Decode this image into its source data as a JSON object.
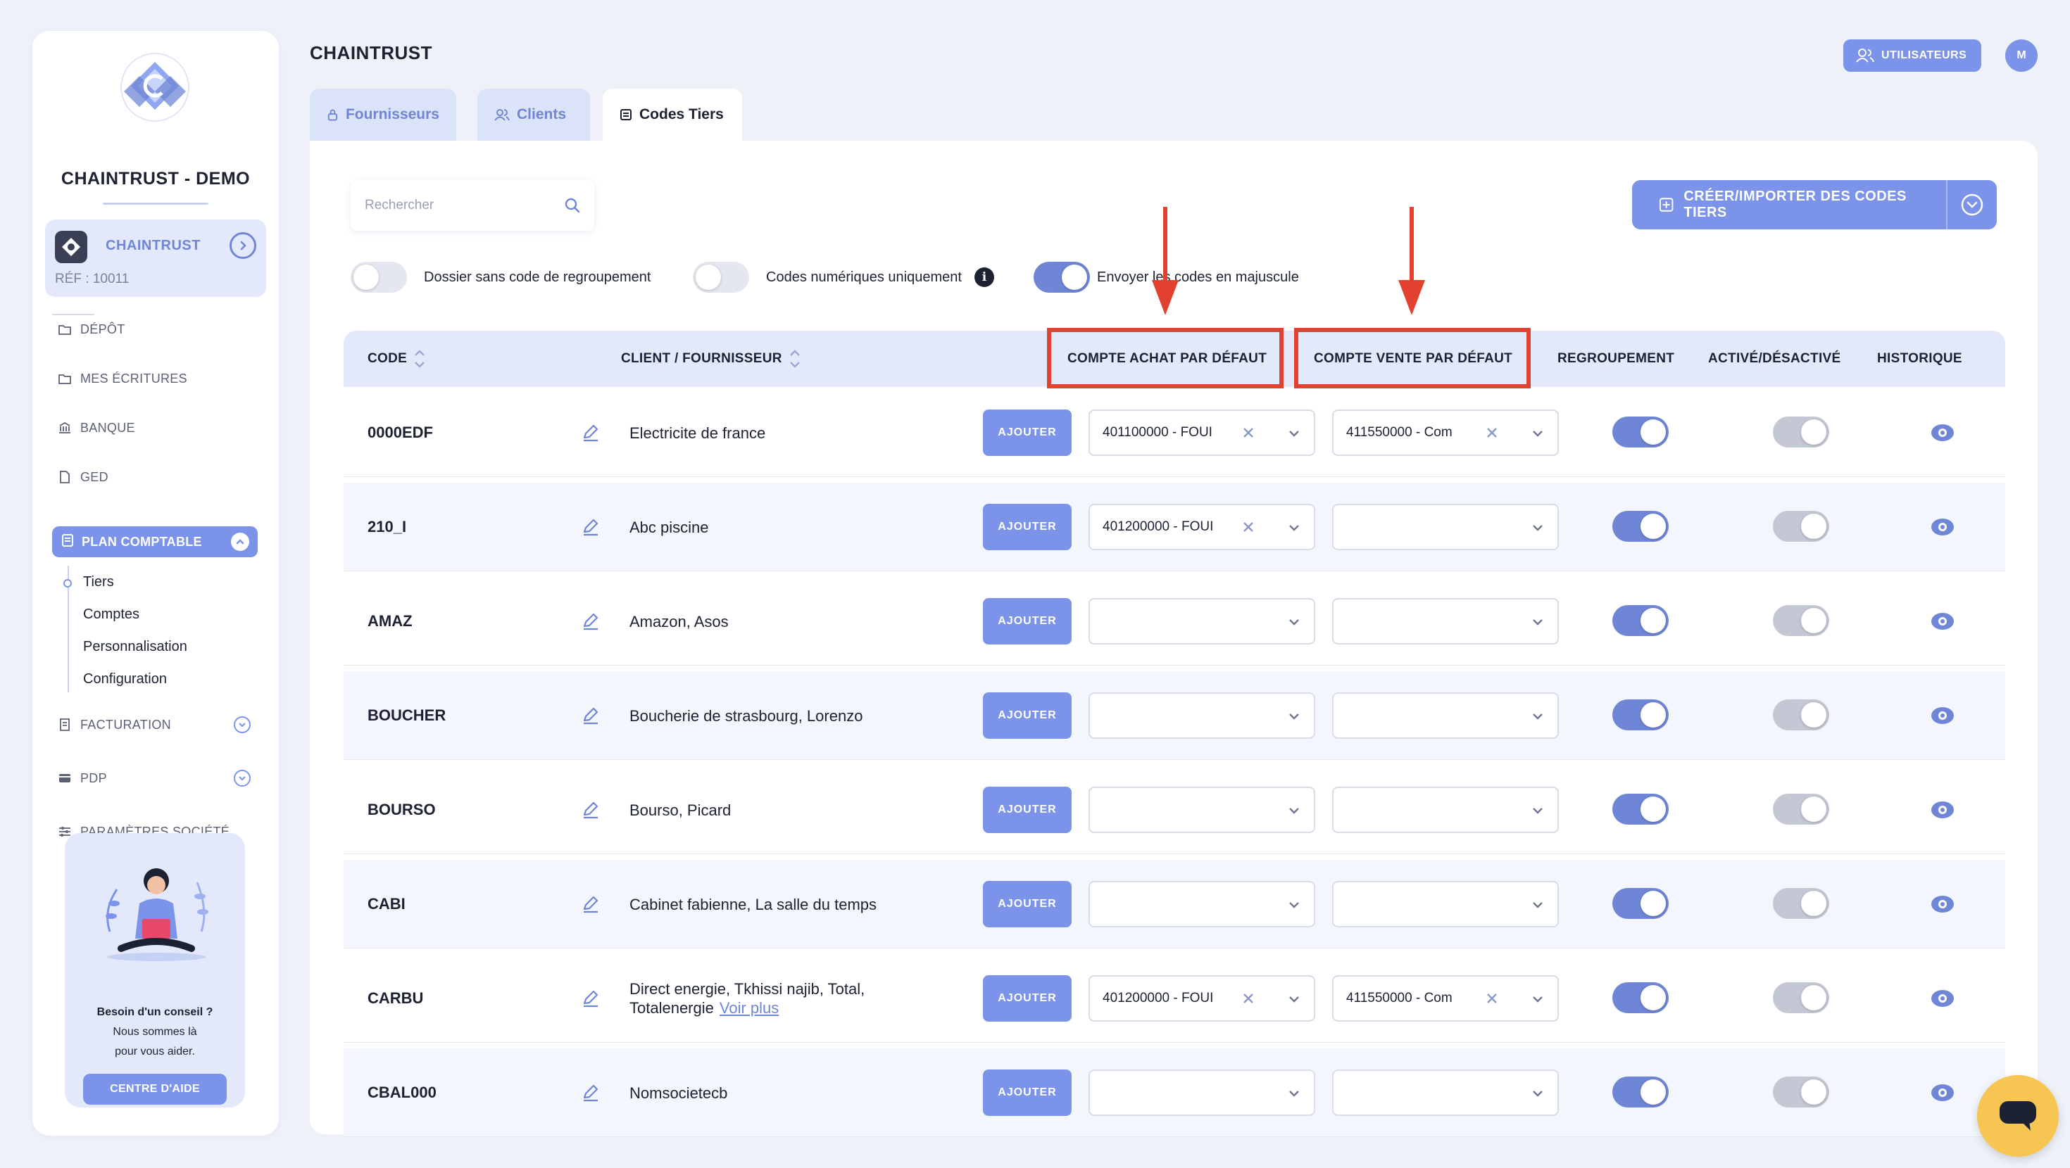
{
  "sidebar": {
    "company_name": "CHAINTRUST - DEMO",
    "current_company": "CHAINTRUST",
    "reference": "RÉF : 10011",
    "nav": [
      {
        "label": "DÉPÔT",
        "icon": "folder-icon"
      },
      {
        "label": "MES ÉCRITURES",
        "icon": "folder-icon"
      },
      {
        "label": "BANQUE",
        "icon": "bank-icon"
      },
      {
        "label": "GED",
        "icon": "document-icon"
      }
    ],
    "active_section": "PLAN COMPTABLE",
    "sub_items": [
      "Tiers",
      "Comptes",
      "Personnalisation",
      "Configuration"
    ],
    "nav_after": [
      {
        "label": "FACTURATION",
        "icon": "invoice-icon"
      },
      {
        "label": "PDP",
        "icon": "card-icon"
      },
      {
        "label": "PARAMÈTRES SOCIÉTÉ",
        "icon": "sliders-icon"
      }
    ],
    "help": {
      "line1": "Besoin d'un conseil ?",
      "line2": "Nous sommes là",
      "line3": "pour vous aider.",
      "button": "CENTRE D'AIDE"
    }
  },
  "header": {
    "title": "CHAINTRUST",
    "users_button": "UTILISATEURS",
    "avatar_initial": "M",
    "tabs": [
      {
        "label": "Fournisseurs",
        "active": false
      },
      {
        "label": "Clients",
        "active": false
      },
      {
        "label": "Codes Tiers",
        "active": true
      }
    ]
  },
  "toolbar": {
    "search_placeholder": "Rechercher",
    "create_button": "CRÉER/IMPORTER DES CODES TIERS",
    "options": [
      {
        "label": "Dossier sans code de regroupement",
        "on": false
      },
      {
        "label": "Codes numériques uniquement",
        "on": false,
        "info": "i"
      },
      {
        "label": "Envoyer les codes en majuscule",
        "on": true
      }
    ]
  },
  "table": {
    "columns": {
      "code": "CODE",
      "client": "CLIENT / FOURNISSEUR",
      "achat": "COMPTE ACHAT PAR DÉFAUT",
      "vente": "COMPTE VENTE PAR DÉFAUT",
      "regroupement": "REGROUPEMENT",
      "active": "ACTIVÉ/DÉSACTIVÉ",
      "historique": "HISTORIQUE"
    },
    "add_label": "AJOUTER",
    "see_more": "Voir plus",
    "rows": [
      {
        "code": "0000EDF",
        "client": "Electricite de france",
        "achat": "401100000 - FOUI",
        "vente": "411550000 - Com"
      },
      {
        "code": "210_I",
        "client": "Abc piscine",
        "achat": "401200000 - FOUI",
        "vente": ""
      },
      {
        "code": "AMAZ",
        "client": "Amazon, Asos",
        "achat": "",
        "vente": ""
      },
      {
        "code": "BOUCHER",
        "client": "Boucherie de strasbourg, Lorenzo",
        "achat": "",
        "vente": ""
      },
      {
        "code": "BOURSO",
        "client": "Bourso, Picard",
        "achat": "",
        "vente": ""
      },
      {
        "code": "CABI",
        "client": "Cabinet fabienne, La salle du temps",
        "achat": "",
        "vente": ""
      },
      {
        "code": "CARBU",
        "client": "Direct energie, Tkhissi najib, Total,",
        "client2": "Totalenergie",
        "achat": "401200000 - FOUI",
        "vente": "411550000 - Com"
      },
      {
        "code": "CBAL000",
        "client": "Nomsocietecb",
        "achat": "",
        "vente": ""
      }
    ]
  },
  "colors": {
    "accent": "#7b93e8",
    "annotation": "#e3412f",
    "background": "#eef1f8"
  }
}
